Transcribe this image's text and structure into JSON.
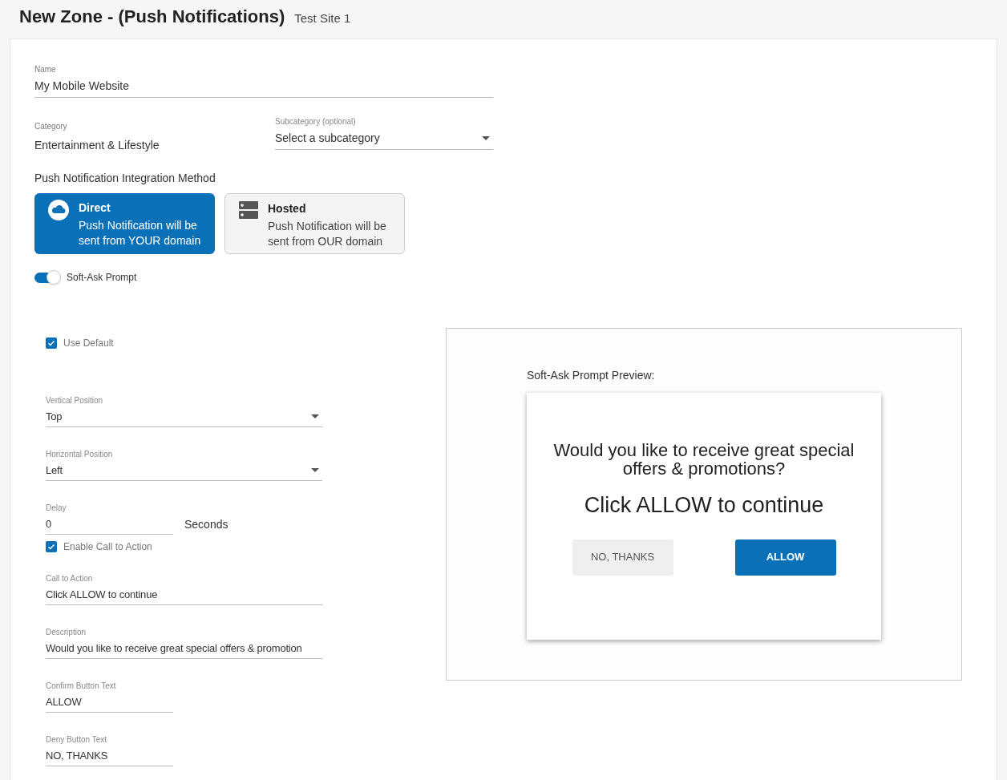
{
  "header": {
    "title": "New Zone - (Push Notifications)",
    "site": "Test Site 1"
  },
  "name_field": {
    "label": "Name",
    "value": "My Mobile Website"
  },
  "category": {
    "label": "Category",
    "value": "Entertainment & Lifestyle"
  },
  "subcategory": {
    "label": "Subcategory (optional)",
    "value": "Select a subcategory"
  },
  "integration": {
    "label": "Push Notification Integration Method",
    "options": [
      {
        "kind": "cloud",
        "title": "Direct",
        "description": "Push Notification will be sent from YOUR domain",
        "selected": true
      },
      {
        "kind": "server",
        "title": "Hosted",
        "description": "Push Notification will be sent from OUR domain",
        "selected": false
      }
    ]
  },
  "soft_ask_toggle": {
    "label": "Soft-Ask Prompt",
    "on": true
  },
  "use_default": {
    "label": "Use Default",
    "checked": true
  },
  "fields": [
    {
      "kind": "select",
      "label": "Vertical Position",
      "value": "Top",
      "narrow": false
    },
    {
      "kind": "select",
      "label": "Horizontal Position",
      "value": "Left",
      "narrow": false
    },
    {
      "kind": "text",
      "label": "Delay",
      "value": "0",
      "narrow": true,
      "suffix": "Seconds"
    },
    {
      "kind": "checkbox",
      "label": "Enable Call to Action",
      "checked": true
    },
    {
      "kind": "text",
      "label": "Call to Action",
      "value": "Click ALLOW to continue",
      "narrow": false
    },
    {
      "kind": "text",
      "label": "Description",
      "value": "Would you like to receive great special offers & promotion",
      "narrow": false
    },
    {
      "kind": "text",
      "label": "Confirm Button Text",
      "value": "ALLOW",
      "narrow": true
    },
    {
      "kind": "text",
      "label": "Deny Button Text",
      "value": "NO, THANKS",
      "narrow": true
    }
  ],
  "preview": {
    "label": "Soft-Ask Prompt Preview:",
    "title": "Would you like to receive great special offers & promotions?",
    "call_to_action": "Click ALLOW to continue",
    "deny_button": "NO, THANKS",
    "confirm_button": "ALLOW"
  }
}
